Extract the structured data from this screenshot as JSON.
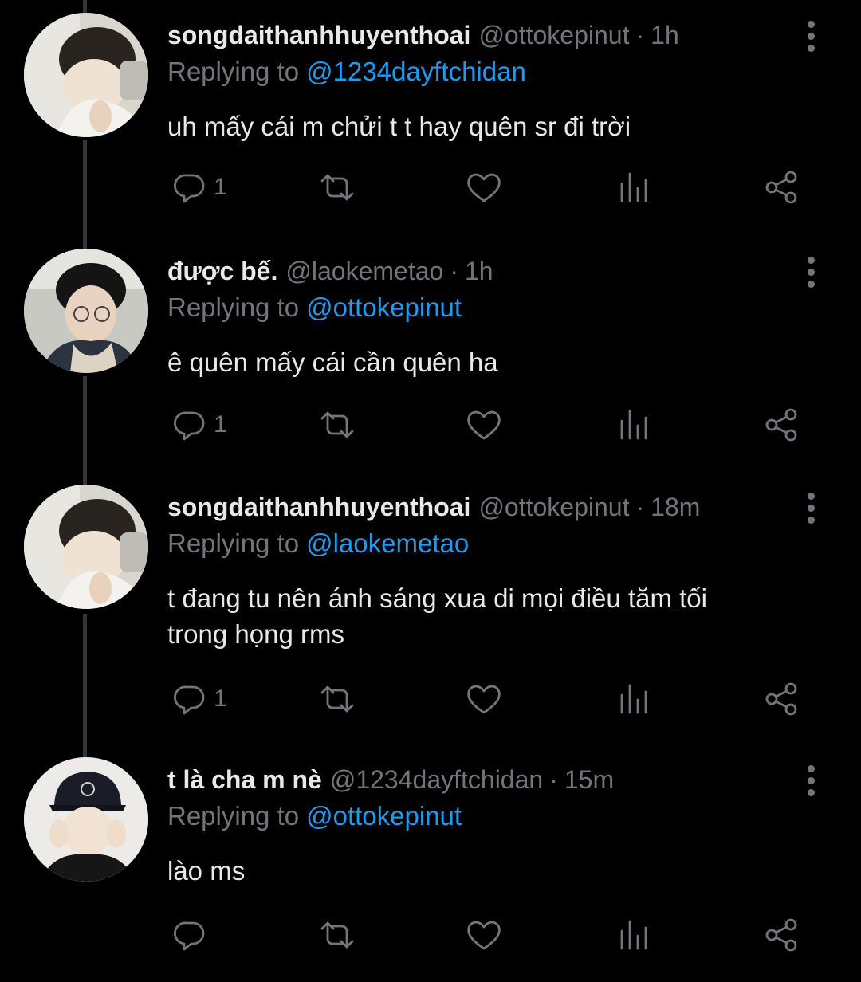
{
  "tweets": [
    {
      "display_name": "songdaithanhhuyenthoai",
      "handle": "@ottokepinut",
      "separator": "·",
      "time": "1h",
      "replying_label": "Replying to",
      "replying_to": "@1234dayftchidan",
      "text": "uh mấy cái m chửi t t hay quên sr đi trời",
      "reply_count": "1"
    },
    {
      "display_name": "được bế.",
      "handle": "@laokemetao",
      "separator": "·",
      "time": "1h",
      "replying_label": "Replying to",
      "replying_to": "@ottokepinut",
      "text": "ê quên mấy cái cần quên ha",
      "reply_count": "1"
    },
    {
      "display_name": "songdaithanhhuyenthoai",
      "handle": "@ottokepinut",
      "separator": "·",
      "time": "18m",
      "replying_label": "Replying to",
      "replying_to": "@laokemetao",
      "text_line1": "t đang tu nên ánh sáng xua di mọi điều tăm tối",
      "text_line2": "trong họng rms",
      "reply_count": "1"
    },
    {
      "display_name": "t là cha m nè",
      "handle": "@1234dayftchidan",
      "separator": "·",
      "time": "15m",
      "replying_label": "Replying to",
      "replying_to": "@ottokepinut",
      "text": "lào ms",
      "reply_count": ""
    }
  ],
  "icons": {
    "reply": "reply-icon",
    "retweet": "retweet-icon",
    "like": "heart-icon",
    "views": "views-icon",
    "share": "share-icon",
    "more": "more-icon"
  },
  "colors": {
    "background": "#000000",
    "primary_text": "#e7e9ea",
    "secondary_text": "#71767b",
    "link": "#1d9bf0",
    "thread_line": "#333639"
  }
}
